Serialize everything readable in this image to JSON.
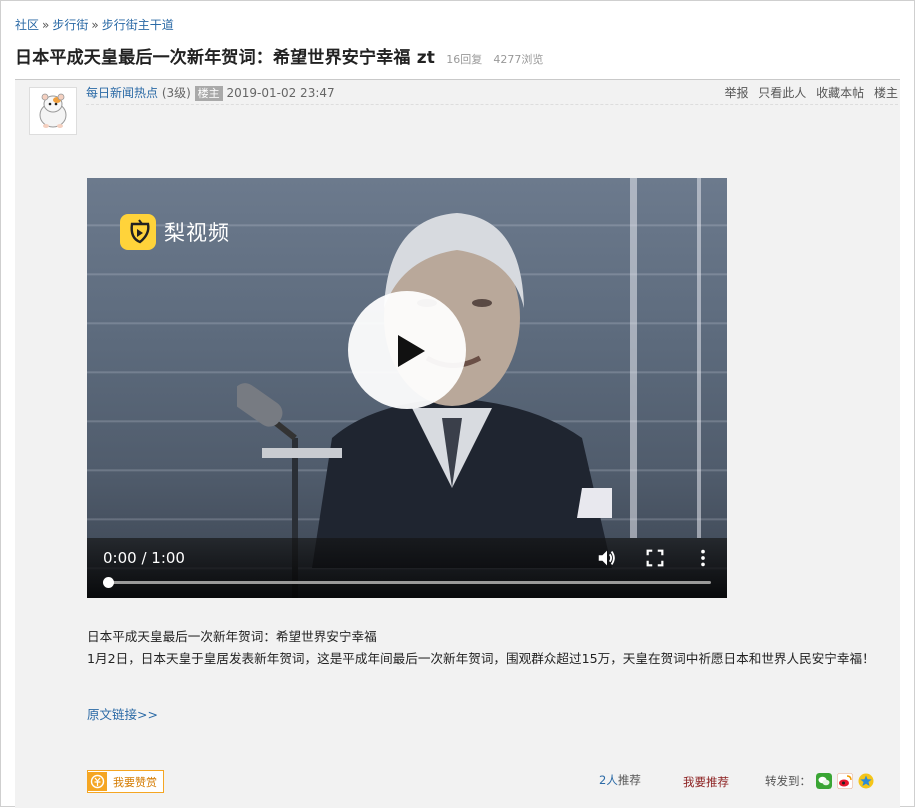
{
  "breadcrumb": {
    "items": [
      "社区",
      "步行街",
      "步行街主干道"
    ],
    "separator": "»"
  },
  "thread": {
    "title": "日本平成天皇最后一次新年贺词：希望世界安宁幸福 zt",
    "replies": "16回复",
    "views": "4277浏览"
  },
  "post": {
    "author": "每日新闻热点",
    "level": "(3级)",
    "badge": "楼主",
    "date": "2019-01-02 23:47",
    "actions": [
      "举报",
      "只看此人",
      "收藏本帖",
      "楼主"
    ],
    "video": {
      "brand": "梨视频",
      "time": "0:00 / 1:00",
      "progress": 0.0
    },
    "text_lines": [
      "日本平成天皇最后一次新年贺词：希望世界安宁幸福",
      "1月2日，日本天皇于皇居发表新年贺词，这是平成年间最后一次新年贺词，围观群众超过15万，天皇在贺词中祈愿日本和世界人民安宁幸福！"
    ],
    "source_link": "原文链接>>"
  },
  "footer": {
    "reward": "我要赞赏",
    "recommend_count": "2人",
    "recommend_suffix": "推荐",
    "recommend_btn": "我要推荐",
    "share_label": "转发到："
  },
  "colors": {
    "link": "#2b6aa6",
    "reward": "#f5a623",
    "recommend": "#8b1d1d",
    "post_bg": "#f2f2f2"
  },
  "icons": [
    "avatar-hamster",
    "play-icon",
    "volume-icon",
    "fullscreen-icon",
    "more-vertical-icon",
    "reward-coin-icon",
    "wechat-icon",
    "weibo-icon",
    "qzone-icon"
  ]
}
